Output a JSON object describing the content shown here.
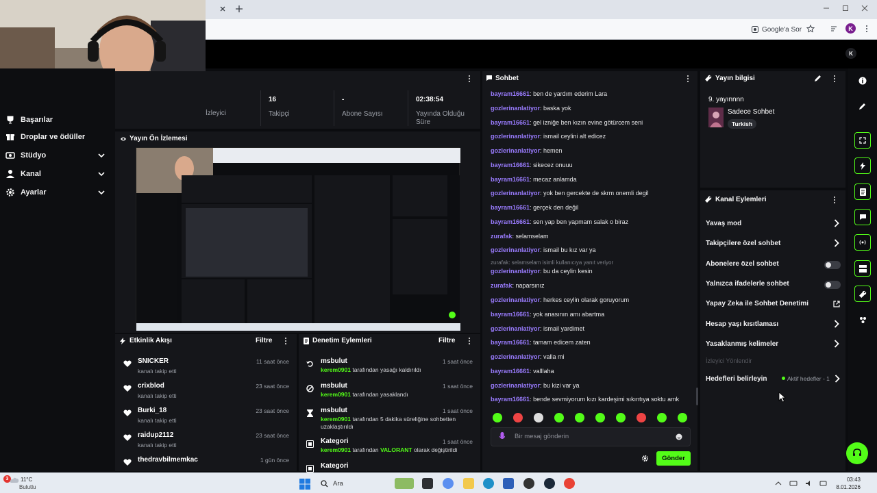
{
  "browser": {
    "ask_google": "Google'a Sor",
    "profile_initial": "K"
  },
  "header": {
    "logo_letter": "K"
  },
  "nav": {
    "items": [
      {
        "label": "Başarılar"
      },
      {
        "label": "Droplar ve ödüller"
      },
      {
        "label": "Stüdyo"
      },
      {
        "label": "Kanal"
      },
      {
        "label": "Ayarlar"
      }
    ]
  },
  "stats": {
    "partial_label": "İzleyici",
    "followers_value": "16",
    "followers_label": "Takipçi",
    "subs_value": "-",
    "subs_label": "Abone Sayısı",
    "uptime_value": "02:38:54",
    "uptime_label": "Yayında Olduğu Süre"
  },
  "preview": {
    "title": "Yayın Ön İzlemesi"
  },
  "activity": {
    "title": "Etkinlik Akışı",
    "filter": "Filtre",
    "items": [
      {
        "name": "SNICKER",
        "sub": "kanalı takip etti",
        "time": "11 saat önce"
      },
      {
        "name": "crixblod",
        "sub": "kanalı takip etti",
        "time": "23 saat önce"
      },
      {
        "name": "Burki_18",
        "sub": "kanalı takip etti",
        "time": "23 saat önce"
      },
      {
        "name": "raidup2112",
        "sub": "kanalı takip etti",
        "time": "23 saat önce"
      },
      {
        "name": "thedravbilmemkac",
        "sub": "",
        "time": "1 gün önce"
      }
    ]
  },
  "moderation": {
    "title": "Denetim Eylemleri",
    "filter": "Filtre",
    "items": [
      {
        "title": "msbulut",
        "actor": "kerem0901",
        "text": "tarafından yasağı kaldırıldı",
        "extra": "",
        "time": "1 saat önce"
      },
      {
        "title": "msbulut",
        "actor": "kerem0901",
        "text": "tarafından yasaklandı",
        "extra": "",
        "time": "1 saat önce"
      },
      {
        "title": "msbulut",
        "actor": "kerem0901",
        "text": "tarafından 5 dakika süreliğine sohbetten",
        "extra": "uzaklaştırıldı",
        "time": "1 saat önce"
      },
      {
        "title": "Kategori",
        "actor": "kerem0901",
        "text": "tarafından",
        "highlight": "VALORANT",
        "text2": "olarak değiştirildi",
        "time": "1 saat önce"
      },
      {
        "title": "Kategori",
        "actor": "",
        "text": "",
        "extra": "",
        "time": ""
      }
    ]
  },
  "chat": {
    "title": "Sohbet",
    "messages": [
      {
        "user": "bayram16661",
        "text": "ben de yardım ederim Lara"
      },
      {
        "user": "gozlerinanlatiyor",
        "text": "baska yok"
      },
      {
        "user": "bayram16661",
        "text": "gel izniğe ben kızın evine götürcem seni"
      },
      {
        "user": "gozlerinanlatiyor",
        "text": "ismail ceylini alt edicez"
      },
      {
        "user": "gozlerinanlatiyor",
        "text": "hemen"
      },
      {
        "user": "bayram16661",
        "text": "sikecez onuuu"
      },
      {
        "user": "bayram16661",
        "text": "mecaz anlamda"
      },
      {
        "user": "gozlerinanlatiyor",
        "text": "yok ben gercekte de skrm onemli degil"
      },
      {
        "user": "bayram16661",
        "text": "gerçek den değil"
      },
      {
        "user": "bayram16661",
        "text": "sen yap ben yapmam salak o biraz"
      },
      {
        "user": "zurafak",
        "text": "selamselam"
      },
      {
        "user": "gozlerinanlatiyor",
        "text": "ismail bu kız var ya"
      },
      {
        "user": "",
        "text": "zurafak: selamselam isimli kullanıcıya yanıt veriyor"
      },
      {
        "user": "gozlerinanlatiyor",
        "text": "bu da ceylin kesin"
      },
      {
        "user": "zurafak",
        "text": "naparsınız"
      },
      {
        "user": "gozlerinanlatiyor",
        "text": "herkes ceylin olarak goruyorum"
      },
      {
        "user": "bayram16661",
        "text": "yok anasının amı abartma"
      },
      {
        "user": "gozlerinanlatiyor",
        "text": "ismail yardimet"
      },
      {
        "user": "bayram16661",
        "text": "tamam edicem zaten"
      },
      {
        "user": "gozlerinanlatiyor",
        "text": "valla mi"
      },
      {
        "user": "bayram16661",
        "text": "valllaha"
      },
      {
        "user": "gozlerinanlatiyor",
        "text": "bu kizi var ya"
      },
      {
        "user": "bayram16661",
        "text": "bende sevmiyorum kızı kardeşimi sıkıntıya soktu amk"
      }
    ],
    "input_placeholder": "Bir mesaj gönderin",
    "send_label": "Gönder"
  },
  "stream_info": {
    "title": "Yayın bilgisi",
    "stream_title": "9. yayınnnn",
    "category": "Sadece Sohbet",
    "tag": "Turkish"
  },
  "channel_actions": {
    "title": "Kanal Eylemleri",
    "items": [
      {
        "label": "Yavaş mod"
      },
      {
        "label": "Takipçilere özel sohbet"
      },
      {
        "label": "Abonelere özel sohbet"
      },
      {
        "label": "Yalnızca ifadelerle sohbet"
      },
      {
        "label": "Yapay Zeka ile Sohbet Denetimi"
      },
      {
        "label": "Hesap yaşı kısıtlaması"
      },
      {
        "label": "Yasaklanmış kelimeler"
      },
      {
        "label": "İzleyici Yönlendir"
      },
      {
        "label": "Hedefleri belirleyin"
      }
    ],
    "goals_status": "Aktif hedefler - 1"
  },
  "taskbar": {
    "weather_badge": "3",
    "temp": "11°C",
    "weather": "Bulutlu",
    "search": "Ara",
    "time": "03:43",
    "date": "8.01.2026"
  },
  "colors": {
    "accent": "#53fc18",
    "username": "#9a7cff",
    "panel": "#15161a"
  }
}
